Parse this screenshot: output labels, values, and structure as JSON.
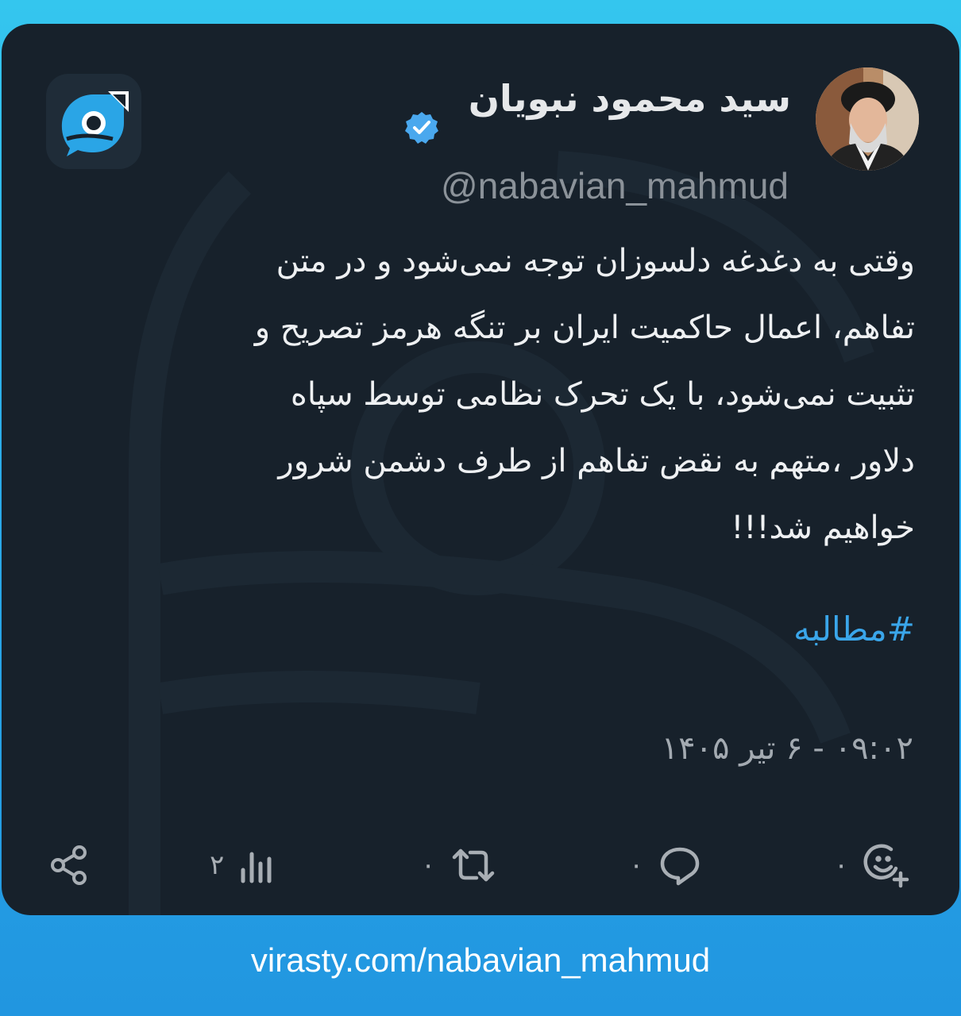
{
  "author": {
    "name": "سید محمود نبویان",
    "handle": "@nabavian_mahmud",
    "verified": true
  },
  "post": {
    "text": "وقتی به دغدغه دلسوزان توجه نمی‌شود و در متن\nتفاهم، اعمال حاکمیت ایران بر تنگه هرمز تصریح و\nتثبیت نمی‌شود، با یک تحرک نظامی توسط سپاه\nدلاور ،متهم به نقض تفاهم از طرف دشمن شرور\nخواهیم شد!!!",
    "hashtag": "#مطالبه",
    "timestamp": "۰۹:۰۲ - ۶ تیر ۱۴۰۵"
  },
  "actions": {
    "share": {
      "icon": "share-icon"
    },
    "views": {
      "icon": "bar-chart-icon",
      "count": "۲"
    },
    "repost": {
      "icon": "repost-icon",
      "count": "۰"
    },
    "reply": {
      "icon": "comment-icon",
      "count": "۰"
    },
    "react": {
      "icon": "add-reaction-icon",
      "count": "۰"
    }
  },
  "footer": {
    "url": "virasty.com/nabavian_mahmud"
  },
  "colors": {
    "card_bg": "#17212b",
    "accent": "#3aa6ea",
    "frame_top": "#34c6ee",
    "frame_bottom": "#2196e0"
  }
}
